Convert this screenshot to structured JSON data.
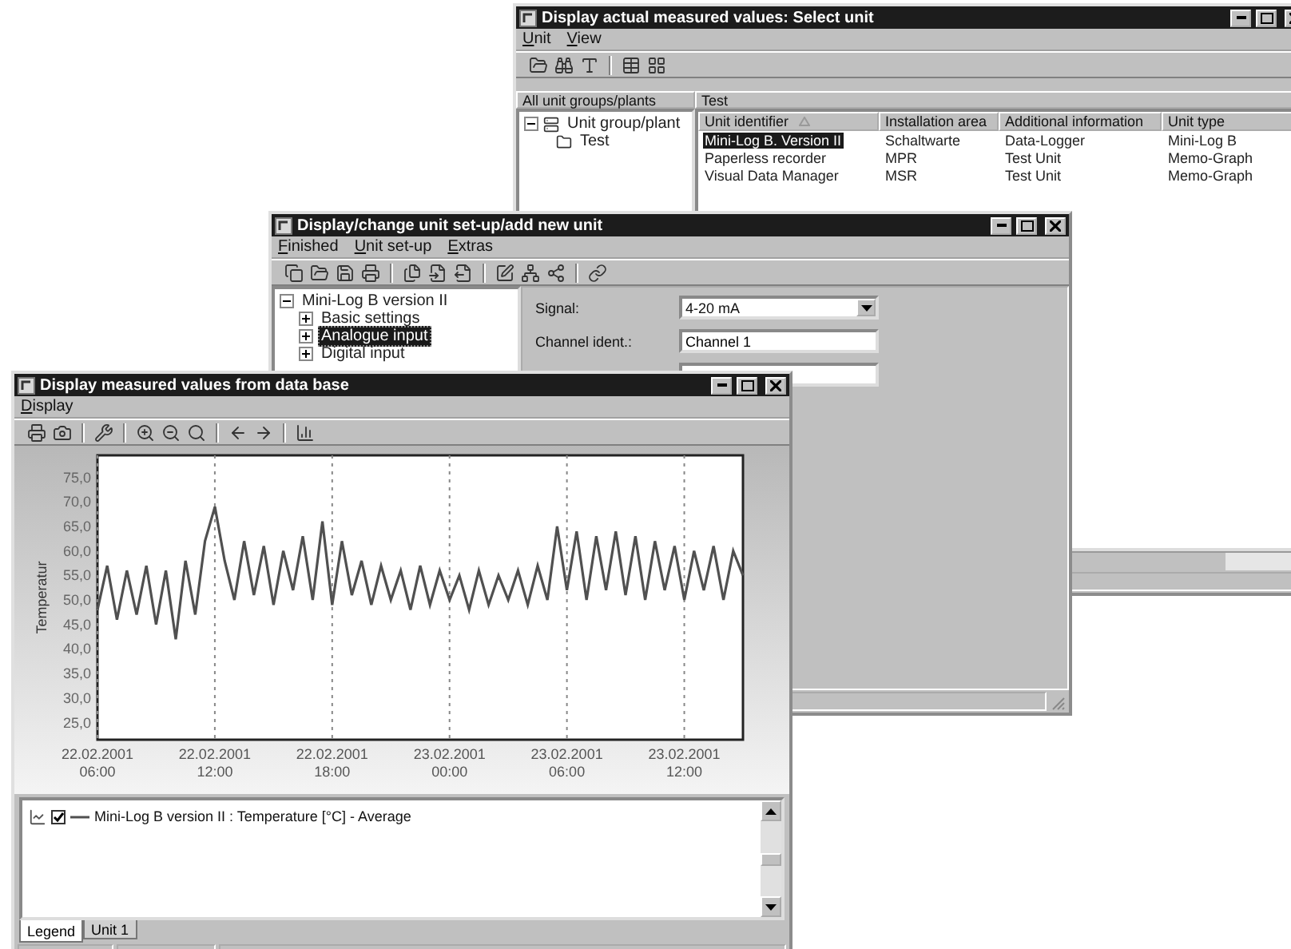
{
  "unit_select_window": {
    "title": "Display actual measured values: Select unit",
    "menu": [
      "Unit",
      "View"
    ],
    "tree_header": "All unit groups/plants",
    "tree": [
      {
        "label": "Unit group/plant",
        "expanded": true,
        "children": [
          {
            "label": "Test"
          }
        ]
      }
    ],
    "list_header": "Test",
    "table": {
      "columns": [
        "Unit identifier",
        "Installation area",
        "Additional information",
        "Unit type"
      ],
      "rows": [
        {
          "cells": [
            "Mini-Log B. Version II",
            "Schaltwarte",
            "Data-Logger",
            "Mini-Log B"
          ],
          "selected": true
        },
        {
          "cells": [
            "Paperless recorder",
            "MPR",
            "Test Unit",
            "Memo-Graph"
          ],
          "selected": false
        },
        {
          "cells": [
            "Visual Data Manager",
            "MSR",
            "Test Unit",
            "Memo-Graph"
          ],
          "selected": false
        }
      ]
    }
  },
  "setup_window": {
    "title": "Display/change unit set-up/add new unit",
    "menu": [
      "Finished",
      "Unit set-up",
      "Extras"
    ],
    "tree": [
      {
        "label": "Mini-Log B version II",
        "expanded": true,
        "selected": false,
        "children": [
          {
            "label": "Basic settings",
            "expanded": false,
            "selected": false
          },
          {
            "label": "Analogue input",
            "expanded": false,
            "selected": true
          },
          {
            "label": "Digital input",
            "expanded": false,
            "selected": false
          }
        ]
      }
    ],
    "fields": [
      {
        "label": "Signal:",
        "kind": "dropdown",
        "value": "4-20 mA"
      },
      {
        "label": "Channel ident.:",
        "kind": "text",
        "value": "Channel 1"
      },
      {
        "kind": "text"
      }
    ]
  },
  "chart_window": {
    "title": "Display measured values from data base",
    "menu": [
      "Display"
    ],
    "chart_data": {
      "type": "line",
      "ylabel": "Temperatur",
      "categories": [
        "22.02.2001 06:00",
        null,
        null,
        null,
        null,
        null,
        null,
        null,
        null,
        null,
        null,
        null,
        "22.02.2001 12:00",
        null,
        null,
        null,
        null,
        null,
        null,
        null,
        null,
        null,
        null,
        null,
        "22.02.2001 18:00",
        null,
        null,
        null,
        null,
        null,
        null,
        null,
        null,
        null,
        null,
        null,
        "23.02.2001 00:00",
        null,
        null,
        null,
        null,
        null,
        null,
        null,
        null,
        null,
        null,
        null,
        "23.02.2001 06:00",
        null,
        null,
        null,
        null,
        null,
        null,
        null,
        null,
        null,
        null,
        null,
        "23.02.2001 12:00",
        null,
        null,
        null,
        null,
        null,
        null
      ],
      "series": [
        {
          "name": "Mini-Log B version II : Temperature [°C] - Average",
          "color": "#505050",
          "values": [
            48,
            57,
            46,
            56,
            47,
            57,
            45,
            56,
            42,
            58,
            47,
            62,
            69,
            58,
            50,
            62,
            51,
            61,
            49,
            60,
            52,
            63,
            50,
            66,
            49,
            62,
            51,
            58,
            49,
            57,
            50,
            56,
            48,
            57,
            49,
            56,
            50,
            55,
            48,
            56,
            49,
            55,
            50,
            56,
            49,
            57,
            50,
            65,
            52,
            64,
            50,
            63,
            52,
            64,
            51,
            63,
            50,
            62,
            52,
            61,
            50,
            60,
            52,
            61,
            50,
            60,
            55
          ]
        }
      ],
      "ylim": [
        21.5,
        79.5
      ],
      "grid": true,
      "yticks": [
        {
          "value": 25,
          "label": "25,0"
        },
        {
          "value": 30,
          "label": "30,0"
        },
        {
          "value": 35,
          "label": "35,0"
        },
        {
          "value": 40,
          "label": "40,0"
        },
        {
          "value": 45,
          "label": "45,0"
        },
        {
          "value": 50,
          "label": "50,0"
        },
        {
          "value": 55,
          "label": "55,0"
        },
        {
          "value": 60,
          "label": "60,0"
        },
        {
          "value": 65,
          "label": "65,0"
        },
        {
          "value": 70,
          "label": "70,0"
        },
        {
          "value": 75,
          "label": "75,0"
        }
      ]
    },
    "legend": [
      {
        "checked": true
      }
    ],
    "tabs": [
      {
        "label": "Legend",
        "selected": true
      },
      {
        "label": "Unit 1",
        "selected": false
      }
    ]
  }
}
